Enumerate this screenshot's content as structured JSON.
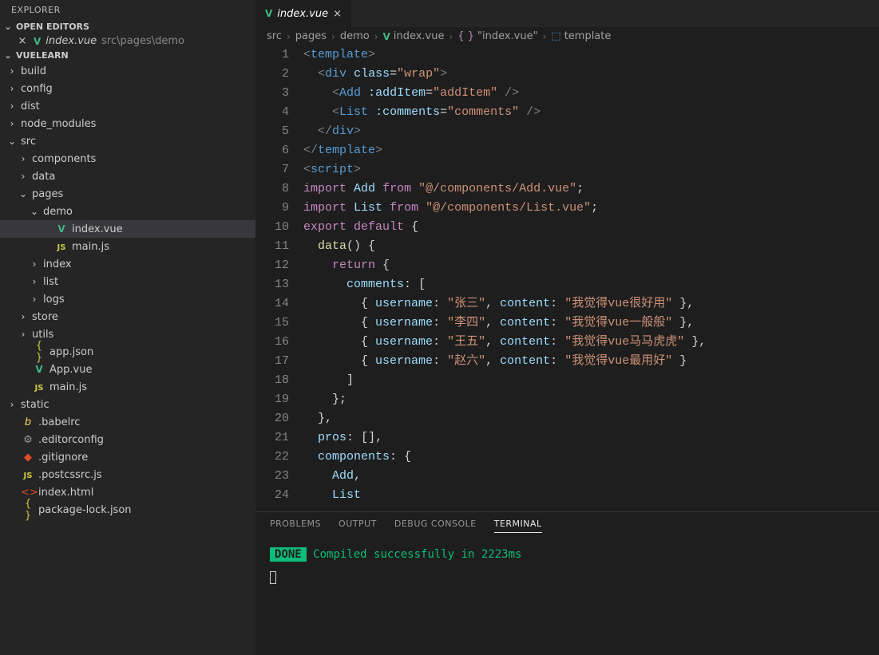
{
  "explorer_title": "EXPLORER",
  "open_editors": {
    "header": "OPEN EDITORS",
    "file": "index.vue",
    "path": "src\\pages\\demo"
  },
  "project": {
    "name": "VUELEARN"
  },
  "tree": [
    {
      "type": "folder",
      "name": "build",
      "indent": 0,
      "exp": false
    },
    {
      "type": "folder",
      "name": "config",
      "indent": 0,
      "exp": false
    },
    {
      "type": "folder",
      "name": "dist",
      "indent": 0,
      "exp": false
    },
    {
      "type": "folder",
      "name": "node_modules",
      "indent": 0,
      "exp": false
    },
    {
      "type": "folder",
      "name": "src",
      "indent": 0,
      "exp": true
    },
    {
      "type": "folder",
      "name": "components",
      "indent": 1,
      "exp": false
    },
    {
      "type": "folder",
      "name": "data",
      "indent": 1,
      "exp": false
    },
    {
      "type": "folder",
      "name": "pages",
      "indent": 1,
      "exp": true
    },
    {
      "type": "folder",
      "name": "demo",
      "indent": 2,
      "exp": true
    },
    {
      "type": "file",
      "name": "index.vue",
      "indent": 3,
      "icon": "vue",
      "selected": true
    },
    {
      "type": "file",
      "name": "main.js",
      "indent": 3,
      "icon": "js"
    },
    {
      "type": "folder",
      "name": "index",
      "indent": 2,
      "exp": false
    },
    {
      "type": "folder",
      "name": "list",
      "indent": 2,
      "exp": false
    },
    {
      "type": "folder",
      "name": "logs",
      "indent": 2,
      "exp": false
    },
    {
      "type": "folder",
      "name": "store",
      "indent": 1,
      "exp": false
    },
    {
      "type": "folder",
      "name": "utils",
      "indent": 1,
      "exp": false
    },
    {
      "type": "file",
      "name": "app.json",
      "indent": 1,
      "icon": "json"
    },
    {
      "type": "file",
      "name": "App.vue",
      "indent": 1,
      "icon": "vue"
    },
    {
      "type": "file",
      "name": "main.js",
      "indent": 1,
      "icon": "js"
    },
    {
      "type": "folder",
      "name": "static",
      "indent": 0,
      "exp": false
    },
    {
      "type": "file",
      "name": ".babelrc",
      "indent": 0,
      "icon": "babel"
    },
    {
      "type": "file",
      "name": ".editorconfig",
      "indent": 0,
      "icon": "gear"
    },
    {
      "type": "file",
      "name": ".gitignore",
      "indent": 0,
      "icon": "git"
    },
    {
      "type": "file",
      "name": ".postcssrc.js",
      "indent": 0,
      "icon": "js"
    },
    {
      "type": "file",
      "name": "index.html",
      "indent": 0,
      "icon": "html"
    },
    {
      "type": "file",
      "name": "package-lock.json",
      "indent": 0,
      "icon": "json"
    }
  ],
  "tab": {
    "filename": "index.vue"
  },
  "breadcrumb": {
    "parts": [
      "src",
      "pages",
      "demo"
    ],
    "file": "index.vue",
    "scope": "\"index.vue\"",
    "symbol": "template"
  },
  "code_lines": [
    {
      "n": 1,
      "html": "<span class='tok-punct'>&lt;</span><span class='tok-tag'>template</span><span class='tok-punct'>&gt;</span>"
    },
    {
      "n": 2,
      "html": "  <span class='tok-punct'>&lt;</span><span class='tok-tag'>div</span> <span class='tok-attr'>class</span><span class='tok-delim'>=</span><span class='tok-str'>\"wrap\"</span><span class='tok-punct'>&gt;</span>"
    },
    {
      "n": 3,
      "html": "    <span class='tok-punct'>&lt;</span><span class='tok-tag'>Add</span> <span class='tok-attr'>:addItem</span><span class='tok-delim'>=</span><span class='tok-str'>\"addItem\"</span> <span class='tok-punct'>/&gt;</span>"
    },
    {
      "n": 4,
      "html": "    <span class='tok-punct'>&lt;</span><span class='tok-tag'>List</span> <span class='tok-attr'>:comments</span><span class='tok-delim'>=</span><span class='tok-str'>\"comments\"</span> <span class='tok-punct'>/&gt;</span>"
    },
    {
      "n": 5,
      "html": "  <span class='tok-punct'>&lt;/</span><span class='tok-tag'>div</span><span class='tok-punct'>&gt;</span>"
    },
    {
      "n": 6,
      "html": "<span class='tok-punct'>&lt;/</span><span class='tok-tag'>template</span><span class='tok-punct'>&gt;</span>"
    },
    {
      "n": 7,
      "html": "<span class='tok-punct'>&lt;</span><span class='tok-tag'>script</span><span class='tok-punct'>&gt;</span>"
    },
    {
      "n": 8,
      "html": "<span class='tok-keyword'>import</span> <span class='tok-ident'>Add</span> <span class='tok-keyword'>from</span> <span class='tok-str'>\"@/components/Add.vue\"</span><span class='tok-delim'>;</span>"
    },
    {
      "n": 9,
      "html": "<span class='tok-keyword'>import</span> <span class='tok-ident'>List</span> <span class='tok-keyword'>from</span> <span class='tok-str'>\"@/components/List.vue\"</span><span class='tok-delim'>;</span>"
    },
    {
      "n": 10,
      "html": "<span class='tok-keyword'>export</span> <span class='tok-keyword'>default</span> <span class='tok-delim'>{</span>"
    },
    {
      "n": 11,
      "html": "  <span class='tok-func'>data</span><span class='tok-delim'>() {</span>"
    },
    {
      "n": 12,
      "html": "    <span class='tok-keyword'>return</span> <span class='tok-delim'>{</span>"
    },
    {
      "n": 13,
      "html": "      <span class='tok-ident'>comments</span><span class='tok-delim'>:</span> <span class='tok-delim'>[</span>"
    },
    {
      "n": 14,
      "html": "        <span class='tok-delim'>{</span> <span class='tok-ident'>username</span><span class='tok-delim'>:</span> <span class='tok-str'>\"张三\"</span><span class='tok-delim'>,</span> <span class='tok-ident'>content</span><span class='tok-delim'>:</span> <span class='tok-str'>\"我觉得vue很好用\"</span> <span class='tok-delim'>},</span>"
    },
    {
      "n": 15,
      "html": "        <span class='tok-delim'>{</span> <span class='tok-ident'>username</span><span class='tok-delim'>:</span> <span class='tok-str'>\"李四\"</span><span class='tok-delim'>,</span> <span class='tok-ident'>content</span><span class='tok-delim'>:</span> <span class='tok-str'>\"我觉得vue一般般\"</span> <span class='tok-delim'>},</span>"
    },
    {
      "n": 16,
      "html": "        <span class='tok-delim'>{</span> <span class='tok-ident'>username</span><span class='tok-delim'>:</span> <span class='tok-str'>\"王五\"</span><span class='tok-delim'>,</span> <span class='tok-ident'>content</span><span class='tok-delim'>:</span> <span class='tok-str'>\"我觉得vue马马虎虎\"</span> <span class='tok-delim'>},</span>"
    },
    {
      "n": 17,
      "html": "        <span class='tok-delim'>{</span> <span class='tok-ident'>username</span><span class='tok-delim'>:</span> <span class='tok-str'>\"赵六\"</span><span class='tok-delim'>,</span> <span class='tok-ident'>content</span><span class='tok-delim'>:</span> <span class='tok-str'>\"我觉得vue最用好\"</span> <span class='tok-delim'>}</span>"
    },
    {
      "n": 18,
      "html": "      <span class='tok-delim'>]</span>"
    },
    {
      "n": 19,
      "html": "    <span class='tok-delim'>};</span>"
    },
    {
      "n": 20,
      "html": "  <span class='tok-delim'>},</span>"
    },
    {
      "n": 21,
      "html": "  <span class='tok-ident'>pros</span><span class='tok-delim'>:</span> <span class='tok-delim'>[],</span>"
    },
    {
      "n": 22,
      "html": "  <span class='tok-ident'>components</span><span class='tok-delim'>:</span> <span class='tok-delim'>{</span>"
    },
    {
      "n": 23,
      "html": "    <span class='tok-ident'>Add</span><span class='tok-delim'>,</span>"
    },
    {
      "n": 24,
      "html": "    <span class='tok-ident'>List</span>"
    }
  ],
  "panel": {
    "tabs": [
      "PROBLEMS",
      "OUTPUT",
      "DEBUG CONSOLE",
      "TERMINAL"
    ],
    "active": 3,
    "done_label": "DONE",
    "done_msg": "Compiled successfully in 2223ms"
  }
}
